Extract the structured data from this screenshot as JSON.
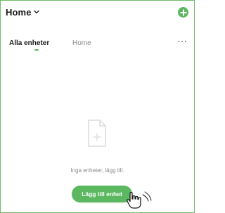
{
  "header": {
    "home_label": "Home",
    "chevron_icon": "chevron-down-icon",
    "add_icon": "plus-circle-icon",
    "accent_color": "#5cb860"
  },
  "tabs": [
    {
      "label": "Alla enheter",
      "active": true
    },
    {
      "label": "Home",
      "active": false
    }
  ],
  "more_label": "···",
  "empty_state": {
    "icon": "blank-document-plus-icon",
    "message": "Inga enheter, lägg till.",
    "button_label": "Lägg till enhet"
  },
  "cursor_icon": "hand-pointer-icon"
}
